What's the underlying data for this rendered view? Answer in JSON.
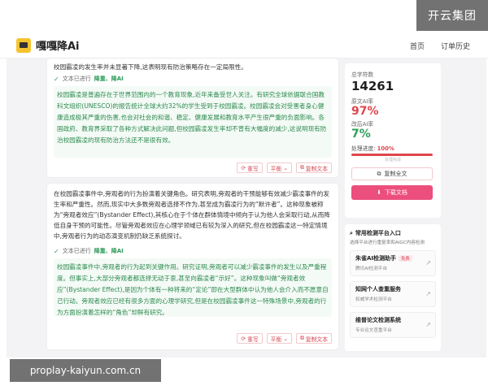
{
  "watermark_top": "开云集团",
  "watermark_bottom": "proplay-kaiyun.com.cn",
  "header": {
    "logo_text": "嘎嘎降Ai",
    "nav": [
      "首页",
      "订单历史"
    ]
  },
  "cards": [
    {
      "original": "校园霸凌的发生率并未显著下降,这表明现有防治策略存在一定局限性。",
      "status_prefix": "文本已进行",
      "status_mode": "降重、降AI",
      "rewritten": "校园霸凌是普遍存在于世界范围内的一个教育现象,近年来备受世人关注。有研究全球依据联合国教科文组织(UNESCO)的报告统计全球大约32%的学生受到于校园霸凌。校园霸凌会对受害者身心健康造成极其严重的伤害,也会对社会的和谐、稳定、健康发展和教育水平产生很严重的负面影响。各国政府、教育界采取了各种方式解决此问题,但校园霸凌发生率却不曾有大幅度的减少,这说明现有防治校园霸凌的现有防治方法还不是很有效。",
      "actions": [
        "重写",
        "平衡",
        "复制文本"
      ]
    },
    {
      "original": "在校园霸凌事件中,旁观者的行为扮演着关键角色。研究表明,旁观者的干预能够有效减少霸凌事件的发生率和严重性。然而,现实中大多数旁观者选择不作为,甚至成为霸凌行为的“默许者”。这种现象被称为“旁观者效应”(Bystander Effect),其核心在于个体在群体情境中倾向于认为他人会采取行动,从而降低自身干预的可能性。尽管旁观者效应在心理学领域已有较为深入的研究,但在校园霸凌这一特定情境中,旁观者行为的动态演变机制仍缺乏系统探讨。",
      "status_prefix": "文本已进行",
      "status_mode": "降重、降AI",
      "rewritten": "校园霸凌事件中,旁观者的行为起到关键作用。研究证明,旁观者可以减少霸凌事件的发生以及严重程度。但事实上,大部分旁观者都选择无动于衷,甚至向霸凌者“示好”。这种现象叫做“旁观者效应”(Bystander Effect),是因为个体有一种将来的“定论”即在大型群体中认为他人会介入而不愿意自己行动。旁观者效应已经有很多方面的心理学研究,但是在校园霸凌事件这一特殊场景中,旁观者的行为方面扮演着怎样的“角色”却鲜有研究。",
      "actions": [
        "重写",
        "平衡",
        "复制文本"
      ]
    }
  ],
  "panel": {
    "total_label": "总字符数",
    "total_value": "14261",
    "orig_ai_label": "原文AI率",
    "orig_ai_value": "97%",
    "new_ai_label": "改后AI率",
    "new_ai_value": "7%",
    "progress_label": "处理进度:",
    "progress_value": "100%",
    "progress_fraction": 1.0,
    "progress_sub": "处理完成",
    "copy_all": "复制全文",
    "download": "下载文档",
    "accent_color": "#ec4f7c"
  },
  "platforms": {
    "title": "常用检测平台入口",
    "subtitle": "选择平台进行重复率和AIGC内容检测",
    "items": [
      {
        "name": "朱雀AI检测助手",
        "tag": "免费",
        "desc": "腾讯AI检测平台"
      },
      {
        "name": "知网个人查重服务",
        "tag": "",
        "desc": "权威学术检测平台"
      },
      {
        "name": "维普论文检测系统",
        "tag": "",
        "desc": "专业论文查重平台"
      }
    ]
  }
}
